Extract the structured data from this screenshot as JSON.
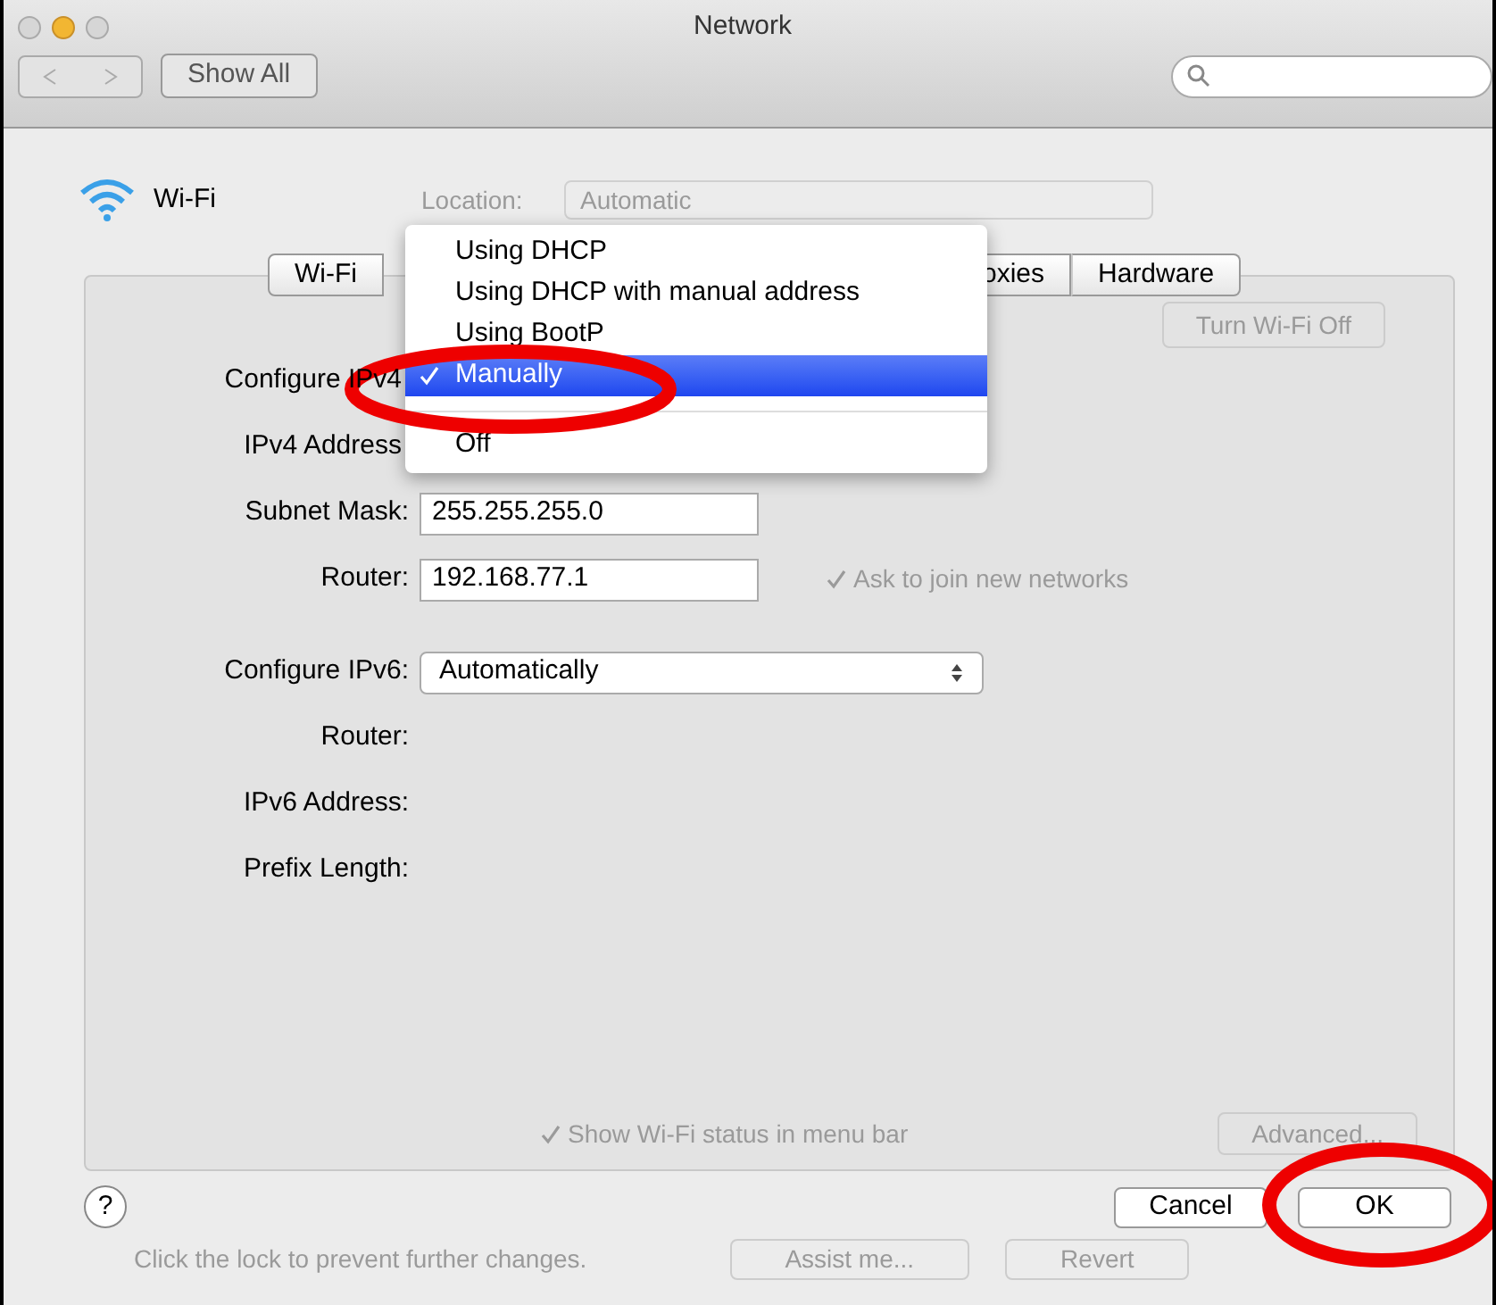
{
  "window": {
    "title": "Network"
  },
  "toolbar": {
    "show_all": "Show All"
  },
  "service": {
    "name": "Wi-Fi"
  },
  "background": {
    "location_label": "Location:",
    "location_value": "Automatic",
    "turn_off": "Turn Wi-Fi Off",
    "ask_to_join": {
      "label": "Ask to join new networks",
      "checked": true
    },
    "show_status": {
      "label": "Show Wi-Fi status in menu bar",
      "checked": true
    },
    "advanced": "Advanced...",
    "lock_text": "Click the lock to prevent further changes.",
    "assist": "Assist me...",
    "revert": "Revert"
  },
  "tabs": [
    {
      "label": "Wi-Fi",
      "selected": false
    },
    {
      "label": "oxies",
      "selected": false
    },
    {
      "label": "Hardware",
      "selected": false
    }
  ],
  "form": [
    {
      "label": "Configure IPv4",
      "kind": "covered"
    },
    {
      "label": "IPv4 Address",
      "kind": "covered"
    },
    {
      "label": "Subnet Mask:",
      "kind": "field",
      "value": "255.255.255.0"
    },
    {
      "label": "Router:",
      "kind": "field",
      "value": "192.168.77.1"
    },
    {
      "label": "Configure IPv6:",
      "kind": "select",
      "value": "Automatically"
    },
    {
      "label": "Router:",
      "kind": "empty"
    },
    {
      "label": "IPv6 Address:",
      "kind": "empty"
    },
    {
      "label": "Prefix Length:",
      "kind": "empty"
    }
  ],
  "menu": [
    {
      "kind": "item",
      "label": "Using DHCP",
      "checked": false,
      "selected": false
    },
    {
      "kind": "item",
      "label": "Using DHCP with manual address",
      "checked": false,
      "selected": false
    },
    {
      "kind": "item",
      "label": "Using BootP",
      "checked": false,
      "selected": false
    },
    {
      "kind": "item",
      "label": "Manually",
      "checked": true,
      "selected": true
    },
    {
      "kind": "separator"
    },
    {
      "kind": "item",
      "label": "Off",
      "checked": false,
      "selected": false
    }
  ],
  "buttons": {
    "help": "?",
    "cancel": "Cancel",
    "ok": "OK"
  }
}
